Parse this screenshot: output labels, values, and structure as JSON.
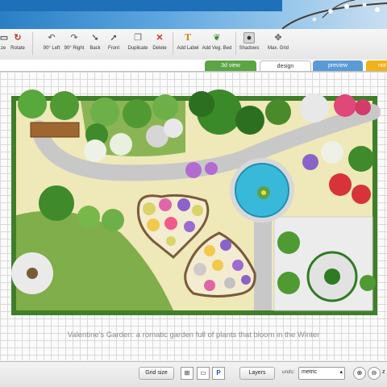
{
  "toolbar": {
    "partial_left_label": "ze",
    "rotate_label": "Rotate",
    "left90_label": "90° Left",
    "right90_label": "90° Right",
    "back_label": "Back",
    "front_label": "Front",
    "duplicate_label": "Duplicate",
    "delete_label": "Delete",
    "add_label_label": "Add Label",
    "add_veg_bed_label": "Add Veg. Bed",
    "shadows_label": "Shadows",
    "max_grid_label": "Max. Grid"
  },
  "tabs": [
    {
      "label": "3d view",
      "color": "#5ba545"
    },
    {
      "label": "design",
      "color": "#ffffff"
    },
    {
      "label": "preview",
      "color": "#5b9bd5"
    },
    {
      "label": "not",
      "color": "#f0b21b"
    }
  ],
  "canvas": {
    "caption": "Valentine's Garden: a romatic garden full of plants that bloom in the Winter"
  },
  "statusbar": {
    "grid_size_label": "Grid size",
    "p_label": "P",
    "layers_label": "Layers",
    "units_label": "units:",
    "units_value": "metric",
    "units_options": [
      "metric"
    ],
    "partial_right_label": "z"
  },
  "colors": {
    "lawn": "#7fae4a",
    "path": "#c8c8c8",
    "sand": "#efe8b8",
    "hedge": "#3f7f2a",
    "water": "#39b9d9"
  }
}
